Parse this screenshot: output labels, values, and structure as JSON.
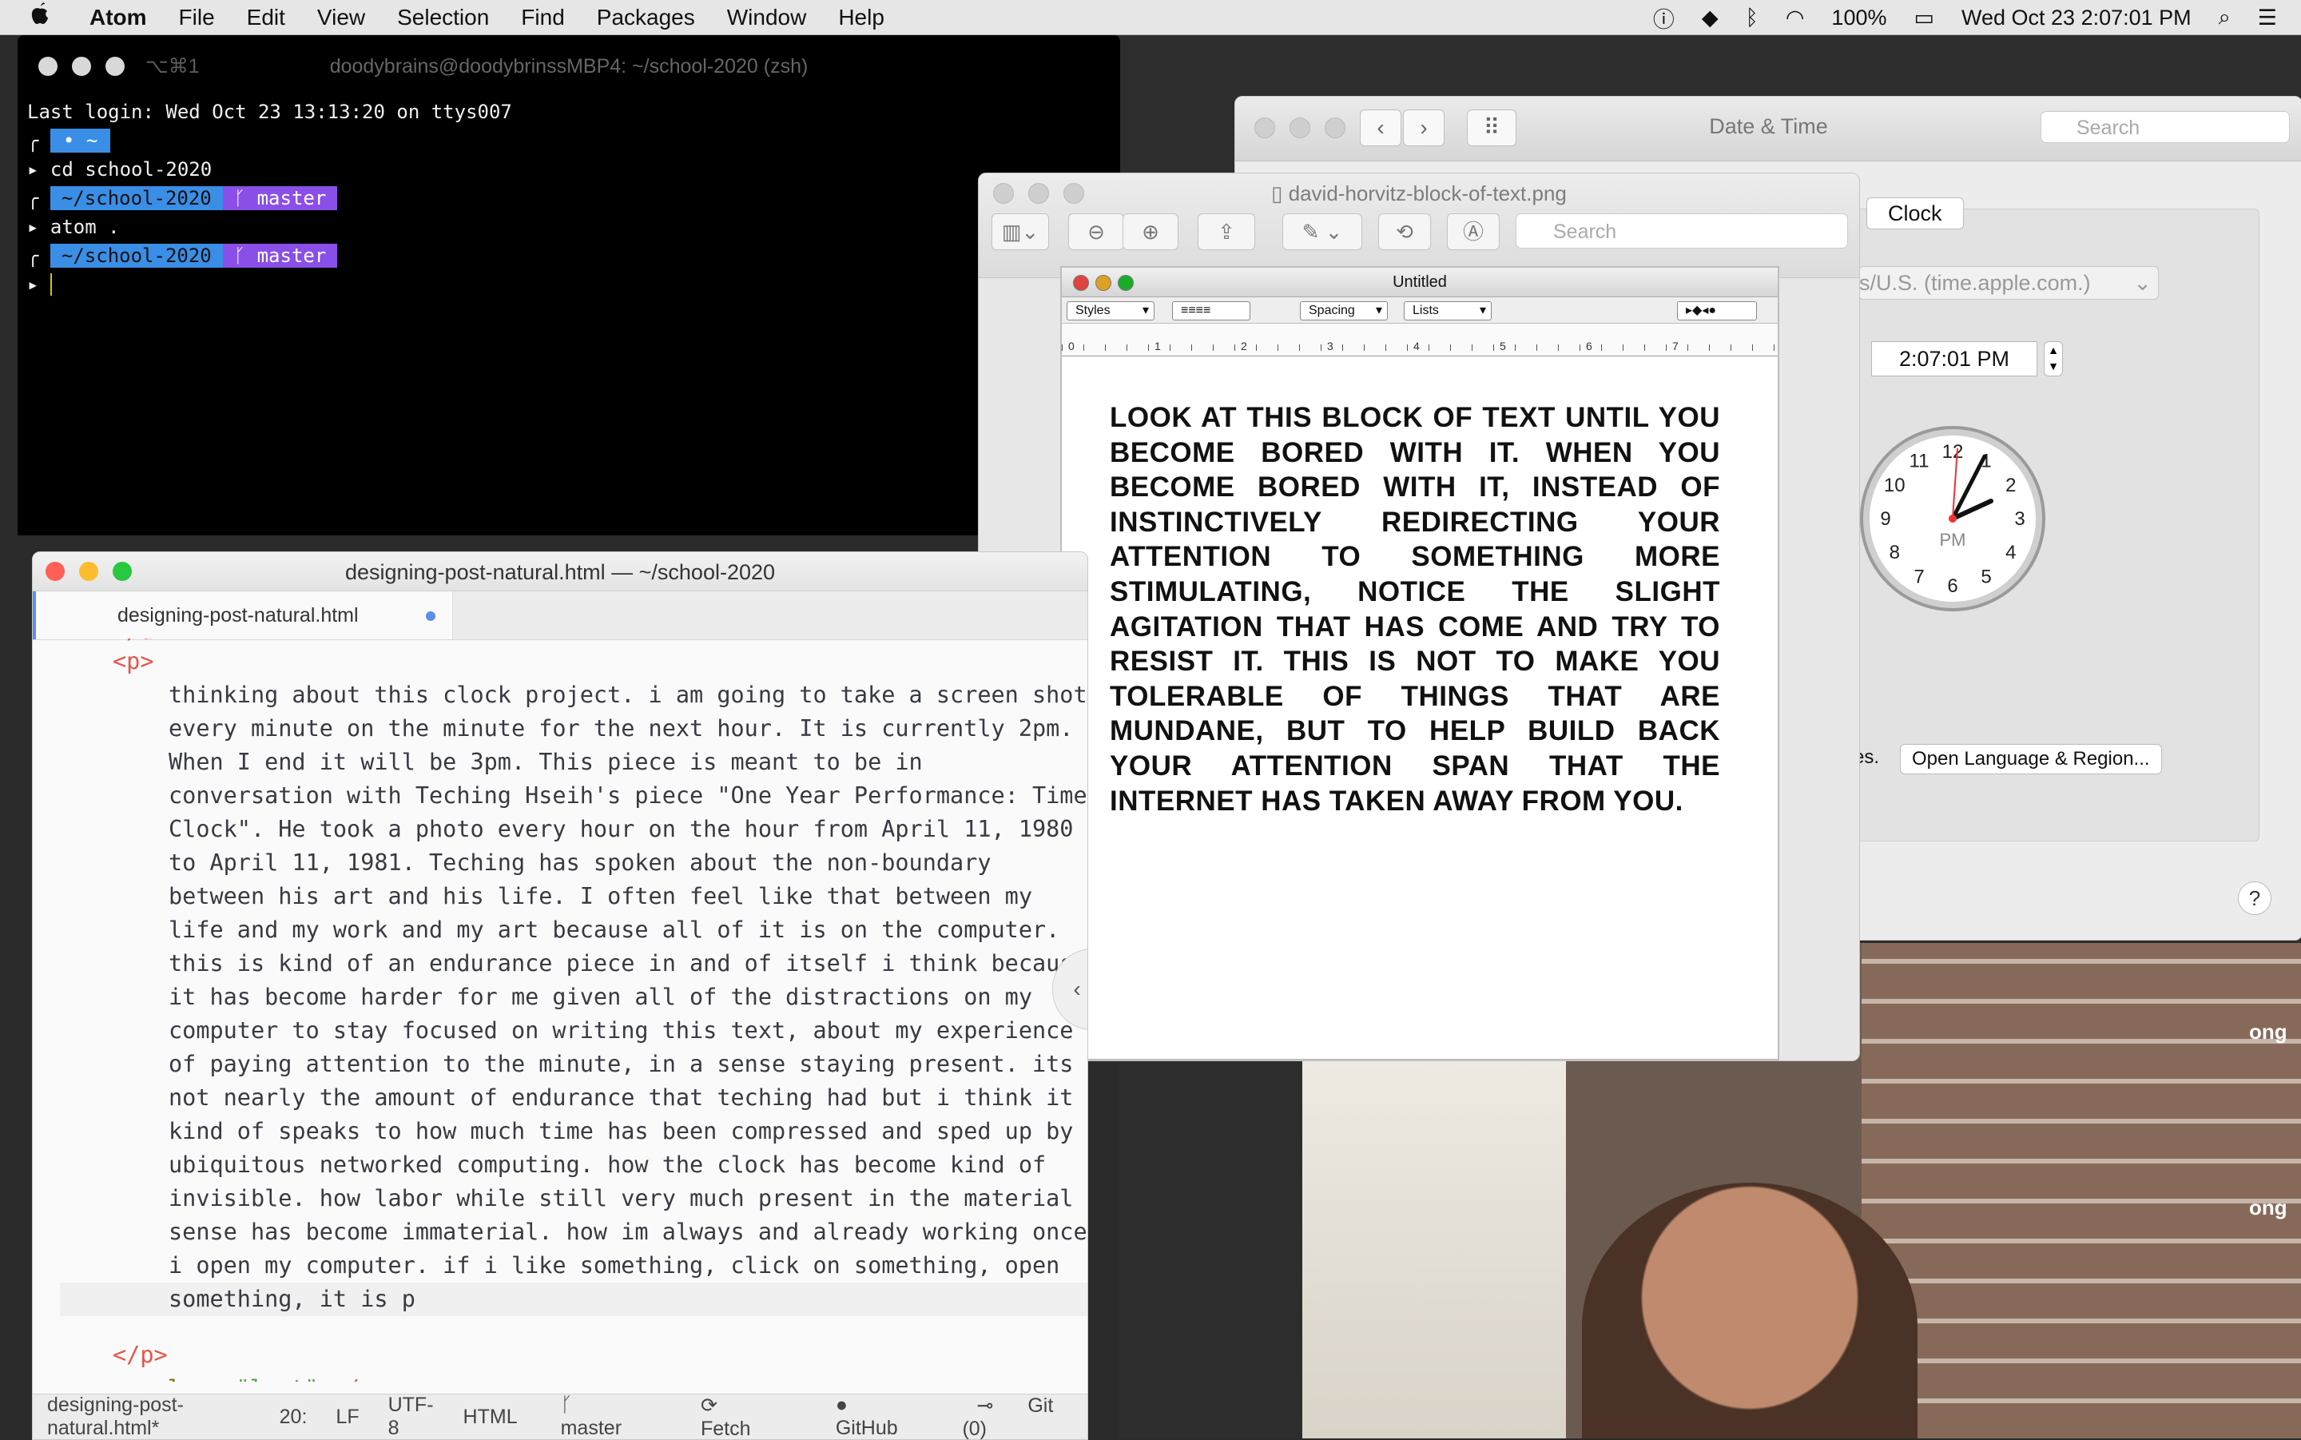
{
  "menubar": {
    "apple_icon": "apple-logo",
    "app_name": "Atom",
    "menus": [
      "File",
      "Edit",
      "View",
      "Selection",
      "Find",
      "Packages",
      "Window",
      "Help"
    ],
    "battery": "100%",
    "clock": "Wed Oct 23  2:07:01 PM"
  },
  "terminal": {
    "shortcut": "⌥⌘1",
    "title": "doodybrains@doodybrinssMBP4: ~/school-2020 (zsh)",
    "last_login": "Last login: Wed Oct 23 13:13:20 on ttys007",
    "prompt_home": "~",
    "cmd1": "cd school-2020",
    "path": "~/school-2020",
    "branch": "master",
    "cmd2": "atom ."
  },
  "datetime": {
    "title": "Date & Time",
    "search_placeholder": "Search",
    "tab_clock": "Clock",
    "server": "s/U.S. (time.apple.com.)",
    "time_value": "2:07:01 PM",
    "es_text": "es.",
    "open_language_button": "Open Language & Region...",
    "help": "?",
    "clock_pm": "PM",
    "clock_numbers": [
      "12",
      "1",
      "2",
      "3",
      "4",
      "5",
      "6",
      "7",
      "8",
      "9",
      "10",
      "11"
    ]
  },
  "preview": {
    "title": "david-horvitz-block-of-text.png",
    "search_placeholder": "Search",
    "inner_title": "Untitled",
    "styles": "Styles",
    "spacing": "Spacing",
    "lists": "Lists",
    "ruler_numbers": [
      "0",
      "1",
      "2",
      "3",
      "4",
      "5",
      "6",
      "7"
    ],
    "block_text": "LOOK AT THIS BLOCK OF TEXT UNTIL YOU BECOME BORED WITH IT. WHEN YOU BECOME BORED WITH IT, INSTEAD OF INSTINCTIVELY REDIRECTING YOUR ATTENTION TO SOMETHING MORE STIMULATING, NOTICE THE SLIGHT AGITATION THAT HAS COME AND TRY TO RESIST IT. THIS IS NOT TO MAKE YOU TOLERABLE OF THINGS THAT ARE MUNDANE, BUT TO HELP BUILD BACK YOUR ATTENTION SPAN THAT THE INTERNET HAS TAKEN AWAY FROM YOU."
  },
  "atom": {
    "title": "designing-post-natural.html — ~/school-2020",
    "tab": "designing-post-natural.html",
    "code_open_p": "<p>",
    "code_lines": [
      "thinking about this clock project. i am going to take a screen shot",
      "every minute on the minute for the next hour. It is currently 2pm.",
      "When I end it will be 3pm. This piece is meant to be in",
      "conversation with Teching Hseih's piece \"One Year Performance: Time",
      "Clock\". He took a photo every hour on the hour from April 11, 1980",
      "to April 11, 1981. Teching has spoken about the non-boundary",
      "between his art and his life. I often feel like that between my",
      "life and my work and my art because all of it is on the computer.",
      "this is kind of an endurance piece in and of itself i think because",
      "it has become harder for me given all of the distractions on my",
      "computer to stay focused on writing this text, about my experience",
      "of paying attention to the minute, in a sense staying present. its",
      "not nearly the amount of endurance that teching had but i think it",
      "kind of speaks to how much time has been compressed and sped up by",
      "ubiquitous networked computing. how the clock has become kind of",
      "invisible. how labor while still very much present in the material",
      "sense has become immaterial. how im always and already working once",
      "i open my computer. if i like something, click on something, open",
      "something, it is p"
    ],
    "code_close_p": "</p>",
    "code_last_p_open": "<p ",
    "code_last_attr": "class",
    "code_last_val": "\"last\"",
    "code_last_close": "></p>",
    "status": {
      "file": "designing-post-natural.html*",
      "cursor": "20:",
      "line_ending": "LF",
      "encoding": "UTF-8",
      "grammar": "HTML",
      "branch": "master",
      "fetch": "Fetch",
      "github": "GitHub",
      "git": "Git (0)"
    }
  },
  "webcam": {
    "label1": "ong",
    "label2": "ong"
  },
  "colors": {
    "prompt_blue": "#3a8ee6",
    "prompt_purple": "#8a4fe8",
    "traffic_red": "#fe5f57",
    "traffic_yellow": "#febc2e",
    "traffic_green": "#28c840",
    "atom_accent": "#5e8fe8"
  }
}
